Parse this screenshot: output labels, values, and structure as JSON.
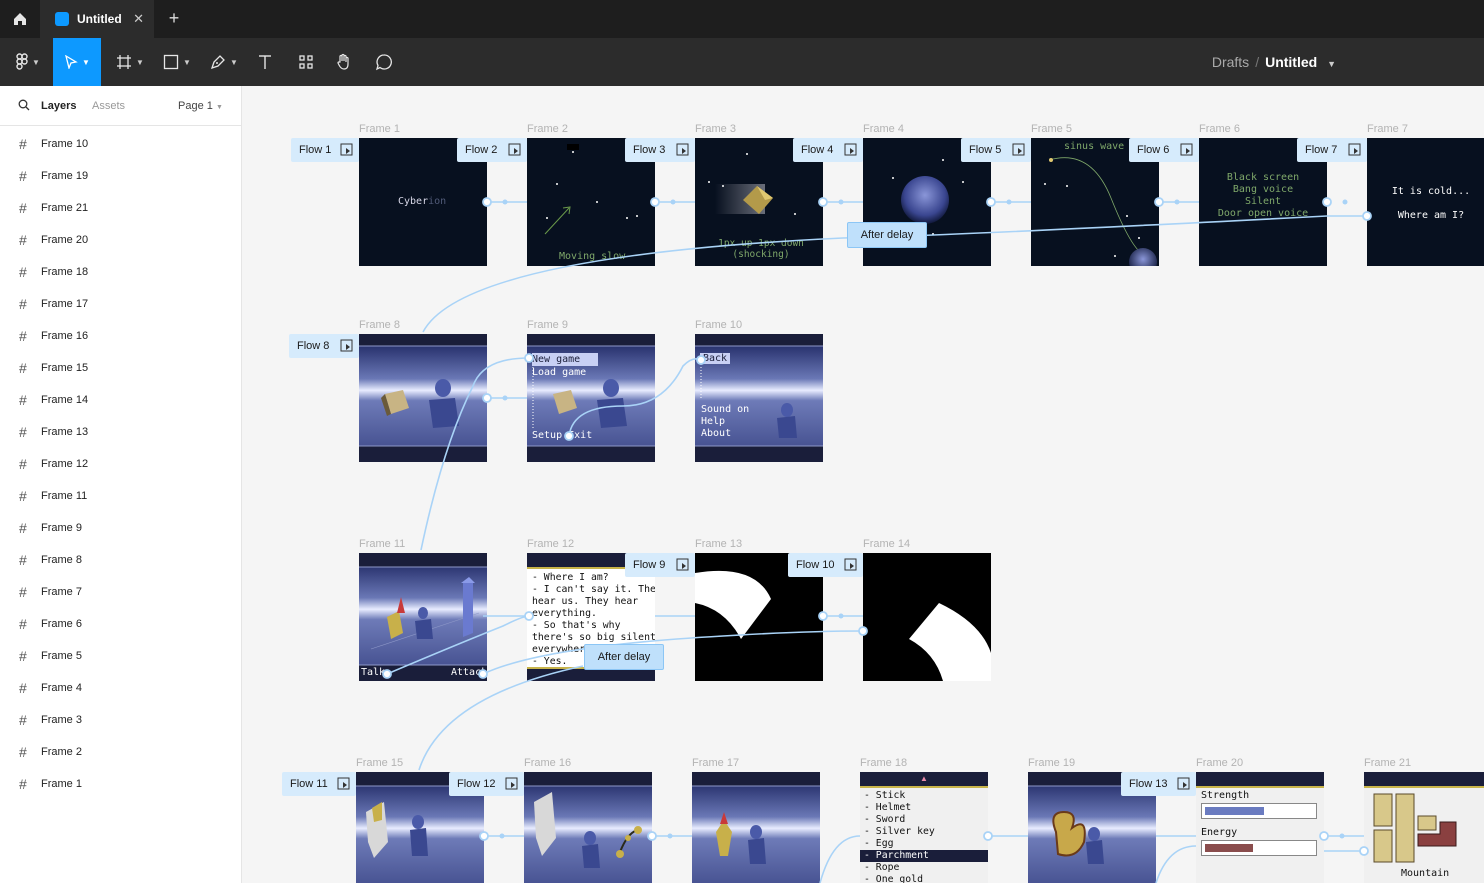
{
  "tab": {
    "title": "Untitled"
  },
  "breadcrumb": {
    "parent": "Drafts",
    "current": "Untitled"
  },
  "sidebar": {
    "tab_layers": "Layers",
    "tab_assets": "Assets",
    "page": "Page 1",
    "layers": [
      "Frame 10",
      "Frame 19",
      "Frame 21",
      "Frame 20",
      "Frame 18",
      "Frame 17",
      "Frame 16",
      "Frame 15",
      "Frame 14",
      "Frame 13",
      "Frame 12",
      "Frame 11",
      "Frame 9",
      "Frame 8",
      "Frame 7",
      "Frame 6",
      "Frame 5",
      "Frame 4",
      "Frame 3",
      "Frame 2",
      "Frame 1"
    ]
  },
  "frames": {
    "f1": "Frame 1",
    "f2": "Frame 2",
    "f3": "Frame 3",
    "f4": "Frame 4",
    "f5": "Frame 5",
    "f6": "Frame 6",
    "f7": "Frame 7",
    "f8": "Frame 8",
    "f9": "Frame 9",
    "f10": "Frame 10",
    "f11": "Frame 11",
    "f12": "Frame 12",
    "f13": "Frame 13",
    "f14": "Frame 14",
    "f15": "Frame 15",
    "f16": "Frame 16",
    "f17": "Frame 17",
    "f18": "Frame 18",
    "f19": "Frame 19",
    "f20": "Frame 20",
    "f21": "Frame 21"
  },
  "flows": {
    "fl1": "Flow 1",
    "fl2": "Flow 2",
    "fl3": "Flow 3",
    "fl4": "Flow 4",
    "fl5": "Flow 5",
    "fl6": "Flow 6",
    "fl7": "Flow 7",
    "fl8": "Flow 8",
    "fl9": "Flow 9",
    "fl10": "Flow 10",
    "fl11": "Flow 11",
    "fl12": "Flow 12",
    "fl13": "Flow 13"
  },
  "triggers": {
    "d1": "After delay",
    "d2": "After delay"
  },
  "content": {
    "f1_title_a": "Cyber",
    "f1_title_b": "ion",
    "f2_text": "Moving slow",
    "f3_text1": "1px up 1px down",
    "f3_text2": "(shocking)",
    "f5_text": "sinus wave",
    "f6_lines": [
      "Black screen",
      "Bang voice",
      "Silent",
      "Door open voice"
    ],
    "f7_line1": "It is cold...",
    "f7_line2": "Where am I?",
    "f9_menu": [
      "New game",
      "Load game",
      "Setup",
      "Exit"
    ],
    "f10_back": "Back",
    "f10_opts": [
      "Sound on",
      "Help",
      "About"
    ],
    "f11_left": "Talk",
    "f11_right": "Attack",
    "f12_dialog": [
      "- Where I am?",
      "- I can't say it. They",
      "hear us. They hear",
      "everything.",
      "- So that's why",
      "there's so big silent",
      "everywhere",
      "- Yes."
    ],
    "f18_items": [
      "- Stick",
      "- Helmet",
      "- Sword",
      "- Silver key",
      "- Egg",
      "- Parchment",
      "- Rope",
      "- One gold"
    ],
    "f20_strength": "Strength",
    "f20_energy": "Energy",
    "f21_label": "Mountain"
  },
  "colors": {
    "accent": "#0d99ff",
    "flow_bg": "#d6ebfc",
    "connector": "#a9d3f7",
    "strength_bar": "#6a7bc0",
    "energy_bar": "#8a4d4d"
  }
}
